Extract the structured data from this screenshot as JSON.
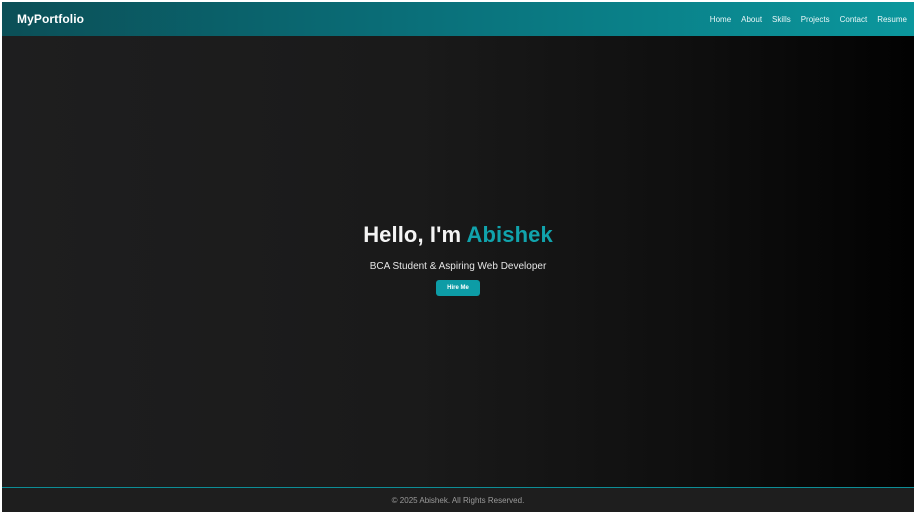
{
  "navbar": {
    "brand": "MyPortfolio",
    "links": [
      {
        "label": "Home"
      },
      {
        "label": "About"
      },
      {
        "label": "Skills"
      },
      {
        "label": "Projects"
      },
      {
        "label": "Contact"
      },
      {
        "label": "Resume"
      }
    ]
  },
  "hero": {
    "greeting": "Hello, I'm ",
    "name": "Abishek",
    "subtitle": "BCA Student & Aspiring Web Developer",
    "cta_label": "Hire Me"
  },
  "footer": {
    "text": "© 2025 Abishek. All Rights Reserved."
  },
  "colors": {
    "accent": "#11a3ac",
    "nav_gradient_start": "#0b4f57",
    "nav_gradient_end": "#0b979d",
    "background": "#1b1b1b"
  }
}
